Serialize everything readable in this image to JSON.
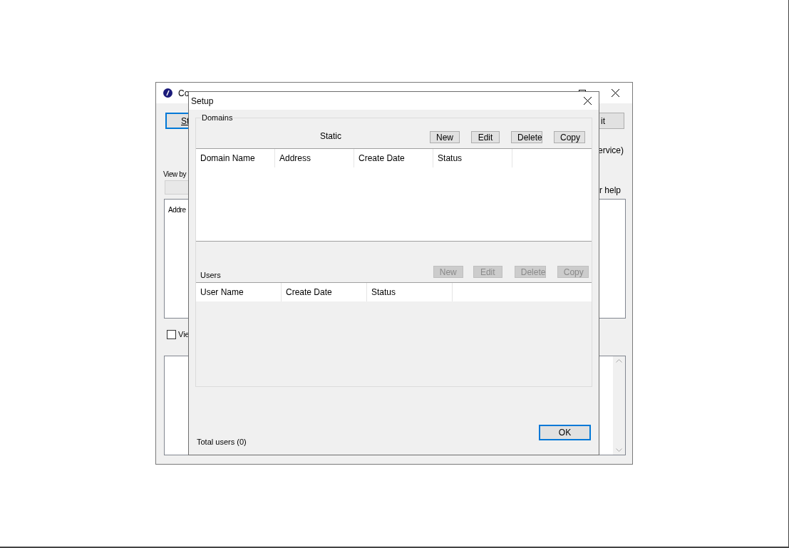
{
  "main_window": {
    "title": "Co",
    "left_button": "St",
    "right_button": "it",
    "service_text": "ervice)",
    "view_by_label": "View by",
    "help_text": "r help",
    "list_header": "Addre",
    "checkbox": {
      "label": "Vie",
      "checked": false
    }
  },
  "dialog": {
    "title": "Setup",
    "domains": {
      "title": "Domains",
      "subtitle": "Static",
      "buttons": [
        {
          "label": "New",
          "disabled": false
        },
        {
          "label": "Edit",
          "disabled": false
        },
        {
          "label": "Delete",
          "disabled": false
        },
        {
          "label": "Copy",
          "disabled": false
        }
      ],
      "columns": [
        "Domain Name",
        "Address",
        "Create Date",
        "Status"
      ]
    },
    "users": {
      "title": "Users",
      "buttons": [
        {
          "label": "New",
          "disabled": true
        },
        {
          "label": "Edit",
          "disabled": true
        },
        {
          "label": "Delete",
          "disabled": true
        },
        {
          "label": "Copy",
          "disabled": true
        }
      ],
      "columns": [
        "User Name",
        "Create Date",
        "Status"
      ]
    },
    "status_text": "Total users (0)",
    "ok_button": "OK"
  }
}
